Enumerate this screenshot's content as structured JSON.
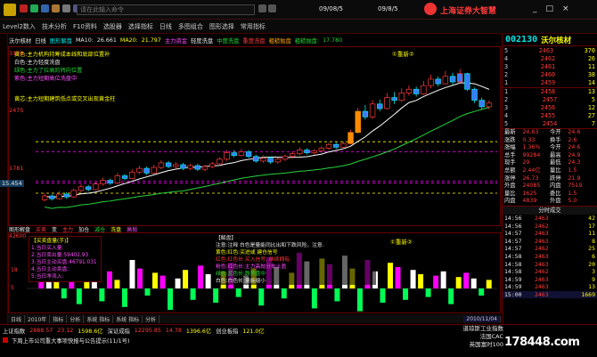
{
  "window": {
    "search_placeholder": "请在此输入命令",
    "time1": "09/08/5",
    "time2": "09/8/5",
    "company_banner": "上海证券大智慧",
    "controls": [
      "_",
      "□",
      "×"
    ]
  },
  "menu": {
    "items": [
      "Level2数入",
      "技术分析",
      "F10资料",
      "选股器",
      "选择指标",
      "日线",
      "多图组合",
      "图形选择",
      "常用指标"
    ]
  },
  "chart": {
    "title_row": [
      "沃尔核材",
      "日线",
      "图形解盘",
      "MA10:",
      "26.661",
      "MA20:",
      "21.797",
      "主力资金",
      "轻度洗盘",
      "中度洗盘",
      "重度洗盘",
      "粗糙抛盘",
      "粗糙抛盘:",
      "17.780"
    ],
    "price_labels": [
      "3175",
      "2475",
      "1781",
      "15.454"
    ],
    "legend_lines": [
      "黄色:主力机构持筹成本线和底部位置补",
      "白色:主力轻度洗盘",
      "绿色:主力了拉高的转向位置",
      "紫色:主力短期高位洗盘中",
      "黄芯:主力短期建筑低点或交叉出现黄金柱"
    ],
    "tag_top": "①重新②",
    "candles": [
      {
        "o": 17.2,
        "c": 17.6,
        "h": 17.9,
        "l": 17.0
      },
      {
        "o": 17.6,
        "c": 17.3,
        "h": 17.8,
        "l": 17.1
      },
      {
        "o": 17.3,
        "c": 17.8,
        "h": 18.1,
        "l": 17.2
      },
      {
        "o": 17.8,
        "c": 17.5,
        "h": 18.0,
        "l": 17.3
      },
      {
        "o": 17.5,
        "c": 18.2,
        "h": 18.4,
        "l": 17.4
      },
      {
        "o": 18.2,
        "c": 18.6,
        "h": 18.9,
        "l": 18.0
      },
      {
        "o": 18.6,
        "c": 18.3,
        "h": 18.8,
        "l": 18.1
      },
      {
        "o": 18.3,
        "c": 18.9,
        "h": 19.1,
        "l": 18.2
      },
      {
        "o": 18.9,
        "c": 19.3,
        "h": 19.6,
        "l": 18.7
      },
      {
        "o": 19.3,
        "c": 19.0,
        "h": 19.5,
        "l": 18.8
      },
      {
        "o": 19.0,
        "c": 19.8,
        "h": 20.1,
        "l": 18.9
      },
      {
        "o": 19.8,
        "c": 19.5,
        "h": 20.0,
        "l": 19.3
      },
      {
        "o": 19.5,
        "c": 20.2,
        "h": 20.5,
        "l": 19.4
      },
      {
        "o": 20.2,
        "c": 20.6,
        "h": 20.9,
        "l": 20.0
      },
      {
        "o": 20.6,
        "c": 20.1,
        "h": 20.8,
        "l": 19.9
      },
      {
        "o": 20.1,
        "c": 20.7,
        "h": 21.0,
        "l": 20.0
      },
      {
        "o": 20.7,
        "c": 21.2,
        "h": 21.5,
        "l": 20.5
      },
      {
        "o": 21.2,
        "c": 20.8,
        "h": 21.4,
        "l": 20.6
      },
      {
        "o": 20.8,
        "c": 21.0,
        "h": 21.3,
        "l": 20.6
      },
      {
        "o": 21.0,
        "c": 20.6,
        "h": 21.2,
        "l": 20.4
      },
      {
        "o": 20.6,
        "c": 20.9,
        "h": 21.1,
        "l": 20.4
      },
      {
        "o": 20.9,
        "c": 20.5,
        "h": 21.1,
        "l": 20.3
      },
      {
        "o": 20.5,
        "c": 20.8,
        "h": 21.0,
        "l": 20.3
      },
      {
        "o": 20.8,
        "c": 21.1,
        "h": 21.3,
        "l": 20.6
      },
      {
        "o": 21.1,
        "c": 21.6,
        "h": 21.8,
        "l": 20.9
      },
      {
        "o": 21.6,
        "c": 22.3,
        "h": 22.6,
        "l": 21.4
      },
      {
        "o": 22.3,
        "c": 22.0,
        "h": 22.6,
        "l": 21.8
      },
      {
        "o": 22.0,
        "c": 22.4,
        "h": 22.7,
        "l": 21.9
      },
      {
        "o": 22.4,
        "c": 21.9,
        "h": 22.6,
        "l": 21.7
      },
      {
        "o": 21.9,
        "c": 21.4,
        "h": 22.1,
        "l": 21.2
      },
      {
        "o": 21.4,
        "c": 21.7,
        "h": 22.0,
        "l": 21.2
      },
      {
        "o": 21.7,
        "c": 21.3,
        "h": 21.9,
        "l": 21.1
      },
      {
        "o": 21.3,
        "c": 21.6,
        "h": 21.8,
        "l": 21.1
      },
      {
        "o": 21.6,
        "c": 21.9,
        "h": 22.1,
        "l": 21.4
      },
      {
        "o": 21.9,
        "c": 22.2,
        "h": 22.4,
        "l": 21.7
      },
      {
        "o": 22.2,
        "c": 22.6,
        "h": 22.9,
        "l": 22.0
      },
      {
        "o": 22.6,
        "c": 22.3,
        "h": 22.8,
        "l": 22.1
      },
      {
        "o": 22.3,
        "c": 22.5,
        "h": 22.7,
        "l": 22.1
      },
      {
        "o": 22.5,
        "c": 22.8,
        "h": 23.0,
        "l": 22.3
      },
      {
        "o": 22.8,
        "c": 23.2,
        "h": 23.4,
        "l": 22.6
      },
      {
        "o": 23.2,
        "c": 22.9,
        "h": 23.4,
        "l": 22.7
      },
      {
        "o": 22.9,
        "c": 23.3,
        "h": 23.5,
        "l": 22.7
      },
      {
        "o": 23.3,
        "c": 24.5,
        "h": 24.8,
        "l": 23.2
      },
      {
        "o": 24.5,
        "c": 26.8,
        "h": 27.2,
        "l": 24.4
      },
      {
        "o": 26.8,
        "c": 26.2,
        "h": 27.5,
        "l": 25.9
      },
      {
        "o": 26.2,
        "c": 27.6,
        "h": 28.0,
        "l": 26.0
      },
      {
        "o": 27.6,
        "c": 27.1,
        "h": 28.1,
        "l": 26.8
      },
      {
        "o": 27.1,
        "c": 28.3,
        "h": 28.8,
        "l": 27.0
      },
      {
        "o": 28.3,
        "c": 28.0,
        "h": 28.9,
        "l": 27.6
      },
      {
        "o": 28.0,
        "c": 28.8,
        "h": 29.3,
        "l": 27.8
      },
      {
        "o": 28.8,
        "c": 29.2,
        "h": 29.6,
        "l": 28.5
      },
      {
        "o": 29.2,
        "c": 28.7,
        "h": 29.5,
        "l": 28.4
      },
      {
        "o": 28.7,
        "c": 29.6,
        "h": 30.1,
        "l": 28.6
      },
      {
        "o": 29.6,
        "c": 30.3,
        "h": 30.8,
        "l": 29.3
      },
      {
        "o": 30.3,
        "c": 29.8,
        "h": 30.6,
        "l": 29.5
      },
      {
        "o": 29.8,
        "c": 30.6,
        "h": 31.2,
        "l": 29.7
      },
      {
        "o": 30.6,
        "c": 30.0,
        "h": 31.0,
        "l": 29.7
      },
      {
        "o": 30.0,
        "c": 30.9,
        "h": 31.4,
        "l": 29.9
      },
      {
        "o": 30.9,
        "c": 29.2,
        "h": 31.0,
        "l": 29.0
      },
      {
        "o": 29.2,
        "c": 28.0,
        "h": 29.4,
        "l": 27.7
      },
      {
        "o": 28.0,
        "c": 27.3,
        "h": 28.3,
        "l": 27.0
      },
      {
        "o": 27.3,
        "c": 27.7,
        "h": 28.0,
        "l": 27.0
      }
    ]
  },
  "subchart": {
    "tabs": [
      "图形解盘",
      "买卖",
      "变",
      "主力",
      "加仓",
      "减仓",
      "洗盘",
      "高抛"
    ],
    "left_box_title": "【买卖盘量(手)】",
    "left_box_lines": [
      "1.当日买入量:",
      "2.当日卖出量:59402.93",
      "3.当日主动买盘:46791.031",
      "4.当日主动卖盘:",
      "5.当日净流入:"
    ],
    "mid_box_title": "【解盘】",
    "mid_box_lines": [
      "注意:注释 白色是量能同比出和下跌风险，注意.",
      "黄色:红色:买进或 建仓信号",
      "红色:红色长:买入信号, 继续拥有.",
      "粉色:红色长:主力高抛分批止盈",
      "绿色:蓝色长:跌势盘中",
      "白色:白色长:量能缩小"
    ],
    "tag": "①重新②",
    "y_labels": [
      "42600",
      "18",
      "5"
    ],
    "bars": [
      {
        "v": 38,
        "c": "#ff00ff"
      },
      {
        "v": 26,
        "c": "#ffffff"
      },
      {
        "v": 18,
        "c": "#ffff00"
      },
      {
        "v": -14,
        "c": "#00ff55"
      },
      {
        "v": 30,
        "c": "#ff00ff"
      },
      {
        "v": -22,
        "c": "#00ff55"
      },
      {
        "v": 16,
        "c": "#ffff00"
      },
      {
        "v": 34,
        "c": "#ffffff"
      },
      {
        "v": -18,
        "c": "#00ff55"
      },
      {
        "v": 24,
        "c": "#ff00ff"
      },
      {
        "v": 12,
        "c": "#ffff00"
      },
      {
        "v": -26,
        "c": "#00ff55"
      },
      {
        "v": 40,
        "c": "#ffffff"
      },
      {
        "v": 28,
        "c": "#ff00ff"
      },
      {
        "v": -10,
        "c": "#00ff55"
      },
      {
        "v": 22,
        "c": "#ffff00"
      },
      {
        "v": 18,
        "c": "#ff00ff"
      },
      {
        "v": -30,
        "c": "#00ff55"
      },
      {
        "v": 14,
        "c": "#ffffff"
      },
      {
        "v": 26,
        "c": "#ffff00"
      },
      {
        "v": -16,
        "c": "#00ff55"
      },
      {
        "v": 32,
        "c": "#ff00ff"
      },
      {
        "v": 20,
        "c": "#ffffff"
      },
      {
        "v": -20,
        "c": "#00ff55"
      },
      {
        "v": 24,
        "c": "#ffff00"
      },
      {
        "v": 36,
        "c": "#ff00ff"
      },
      {
        "v": -12,
        "c": "#00ff55"
      },
      {
        "v": 18,
        "c": "#ffffff"
      },
      {
        "v": 28,
        "c": "#ffff00"
      },
      {
        "v": -24,
        "c": "#00ff55"
      },
      {
        "v": 44,
        "c": "#ff00ff"
      },
      {
        "v": 30,
        "c": "#ffffff"
      },
      {
        "v": -14,
        "c": "#00ff55"
      },
      {
        "v": 22,
        "c": "#ffff00"
      },
      {
        "v": 50,
        "c": "#ff00ff"
      },
      {
        "v": 38,
        "c": "#ffffff"
      },
      {
        "v": -28,
        "c": "#00ff55"
      },
      {
        "v": 42,
        "c": "#ffff00"
      },
      {
        "v": 34,
        "c": "#ff00ff"
      },
      {
        "v": -18,
        "c": "#00ff55"
      },
      {
        "v": 46,
        "c": "#ffffff"
      },
      {
        "v": 28,
        "c": "#ffff00"
      },
      {
        "v": -32,
        "c": "#00ff55"
      },
      {
        "v": 40,
        "c": "#ff00ff"
      },
      {
        "v": 24,
        "c": "#ffffff"
      },
      {
        "v": -20,
        "c": "#00ff55"
      },
      {
        "v": 36,
        "c": "#ffff00"
      },
      {
        "v": 30,
        "c": "#ff00ff"
      },
      {
        "v": -16,
        "c": "#00ff55"
      },
      {
        "v": 26,
        "c": "#ffffff"
      },
      {
        "v": 20,
        "c": "#ffff00"
      },
      {
        "v": -12,
        "c": "#00ff55"
      },
      {
        "v": 18,
        "c": "#ff00ff"
      },
      {
        "v": 24,
        "c": "#ffffff"
      },
      {
        "v": -22,
        "c": "#00ff55"
      },
      {
        "v": 16,
        "c": "#ffff00"
      },
      {
        "v": 22,
        "c": "#ff00ff"
      },
      {
        "v": 14,
        "c": "#ffffff"
      },
      {
        "v": -10,
        "c": "#00ff55"
      },
      {
        "v": 12,
        "c": "#ffff00"
      }
    ]
  },
  "bottom_tabs": [
    "日线",
    "2010年",
    "指标",
    "分析",
    "系统 指标",
    "系统 指标",
    "分析",
    "2010/11/04"
  ],
  "right": {
    "code": "002130",
    "name": "沃尔核材",
    "asks": [
      {
        "label": "5",
        "price": "2463",
        "vol": "370"
      },
      {
        "label": "4",
        "price": "2462",
        "vol": "26"
      },
      {
        "label": "3",
        "price": "2461",
        "vol": "11"
      },
      {
        "label": "2",
        "price": "2460",
        "vol": "38"
      },
      {
        "label": "1",
        "price": "2459",
        "vol": "14"
      }
    ],
    "bids": [
      {
        "label": "1",
        "price": "2458",
        "vol": "13"
      },
      {
        "label": "2",
        "price": "2457",
        "vol": "5"
      },
      {
        "label": "3",
        "price": "2456",
        "vol": "12"
      },
      {
        "label": "4",
        "price": "2455",
        "vol": "27"
      },
      {
        "label": "5",
        "price": "2454",
        "vol": "7"
      }
    ],
    "stats": [
      {
        "k": "最新",
        "v": "24.63",
        "k2": "今开",
        "v2": "24.6"
      },
      {
        "k": "涨跌",
        "v": "0.33",
        "k2": "换手",
        "v2": "2.6"
      },
      {
        "k": "涨幅",
        "v": "1.36%",
        "k2": "今开",
        "v2": "24.6"
      },
      {
        "k": "总手",
        "v": "99284",
        "k2": "最高",
        "v2": "24.9"
      },
      {
        "k": "现手",
        "v": "29",
        "k2": "最低",
        "v2": "24.3"
      },
      {
        "k": "总额",
        "v": "2.44亿",
        "k2": "量比",
        "v2": "1.5"
      },
      {
        "k": "涨停",
        "v": "26.73",
        "k2": "跌停",
        "v2": "21.9"
      },
      {
        "k": "外盘",
        "v": "24085",
        "k2": "内盘",
        "v2": "7519"
      },
      {
        "k": "量比",
        "v": "1625",
        "k2": "委比",
        "v2": "1.5"
      },
      {
        "k": "内盘",
        "v": "4839",
        "k2": "外盘",
        "v2": "5.0"
      }
    ],
    "ticks_title": "分时成交",
    "ticks": [
      {
        "t": "14:56",
        "p": "2463",
        "v": "42"
      },
      {
        "t": "14:56",
        "p": "2462",
        "v": "17"
      },
      {
        "t": "14:57",
        "p": "2463",
        "v": "11"
      },
      {
        "t": "14:57",
        "p": "2463",
        "v": "8"
      },
      {
        "t": "14:57",
        "p": "2462",
        "v": "25"
      },
      {
        "t": "14:58",
        "p": "2463",
        "v": "6"
      },
      {
        "t": "14:58",
        "p": "2463",
        "v": "20"
      },
      {
        "t": "14:58",
        "p": "2462",
        "v": "3"
      },
      {
        "t": "14:59",
        "p": "2463",
        "v": "9"
      },
      {
        "t": "14:59",
        "p": "2463",
        "v": "13"
      },
      {
        "t": "15:00",
        "p": "2463",
        "v": "1669"
      }
    ]
  },
  "ticker": {
    "items": [
      {
        "n": "上证指数",
        "v": "2888.57",
        "c": "23.12",
        "a": "1598.6亿"
      },
      {
        "n": "深证成指",
        "v": "12295.85",
        "c": "14.78",
        "a": "1396.6亿"
      },
      {
        "n": "创业板指",
        "v": "",
        "c": "",
        "a": "121.0亿"
      }
    ],
    "news": "下周上市公司重大事项快报与公告提示(11/1号)",
    "right_label": "道琼斯工业指数",
    "right_label2": "法国CAC",
    "right_label3": "英国富时100",
    "watermark": "178448.com"
  }
}
